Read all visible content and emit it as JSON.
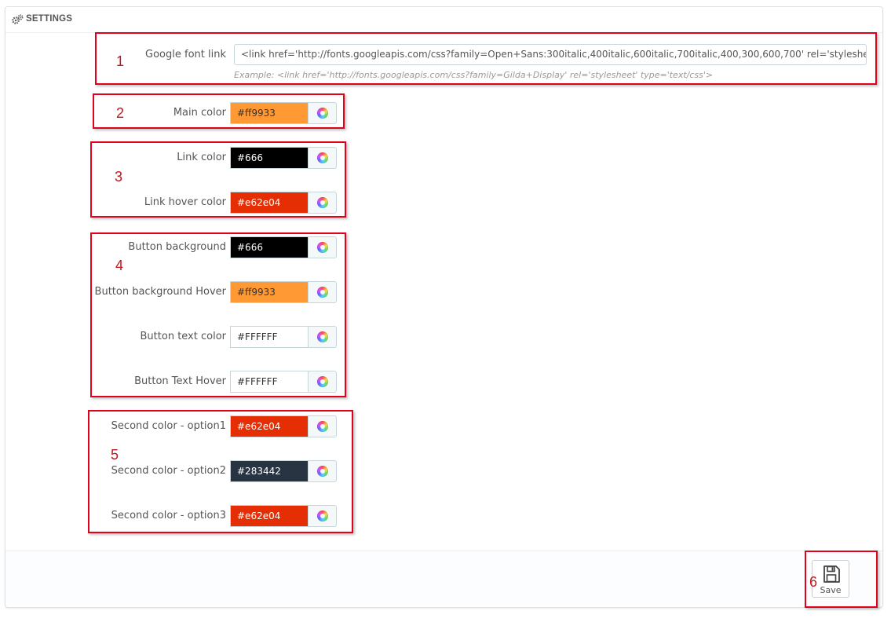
{
  "panel": {
    "heading": "SETTINGS"
  },
  "font": {
    "label": "Google font link",
    "value": "<link href='http://fonts.googleapis.com/css?family=Open+Sans:300italic,400italic,600italic,700italic,400,300,600,700' rel='stylesheet' type='text",
    "help": "Example: <link href='http://fonts.googleapis.com/css?family=Gilda+Display' rel='stylesheet' type='text/css'>"
  },
  "colors": [
    {
      "label": "Main color",
      "value": "#ff9933",
      "bg": "#ff9933",
      "fg": "#333333"
    },
    {
      "label": "Link color",
      "value": "#666",
      "bg": "#000000",
      "fg": "#ffffff"
    },
    {
      "label": "Link hover color",
      "value": "#e62e04",
      "bg": "#e62e04",
      "fg": "#ffffff"
    },
    {
      "label": "Button background",
      "value": "#666",
      "bg": "#000000",
      "fg": "#ffffff"
    },
    {
      "label": "Button background Hover",
      "value": "#ff9933",
      "bg": "#ff9933",
      "fg": "#333333"
    },
    {
      "label": "Button text color",
      "value": "#FFFFFF",
      "bg": "#ffffff",
      "fg": "#333333"
    },
    {
      "label": "Button Text Hover",
      "value": "#FFFFFF",
      "bg": "#ffffff",
      "fg": "#333333"
    },
    {
      "label": "Second color - option1",
      "value": "#e62e04",
      "bg": "#e62e04",
      "fg": "#ffffff"
    },
    {
      "label": "Second color - option2",
      "value": "#283442",
      "bg": "#283442",
      "fg": "#ffffff"
    },
    {
      "label": "Second color - option3",
      "value": "#e62e04",
      "bg": "#e62e04",
      "fg": "#ffffff"
    }
  ],
  "annotations": [
    "1",
    "2",
    "3",
    "4",
    "5",
    "6"
  ],
  "footer": {
    "save_label": "Save"
  },
  "style": {
    "highlight": "#e2001a",
    "annotation_number": "#c4161c"
  }
}
